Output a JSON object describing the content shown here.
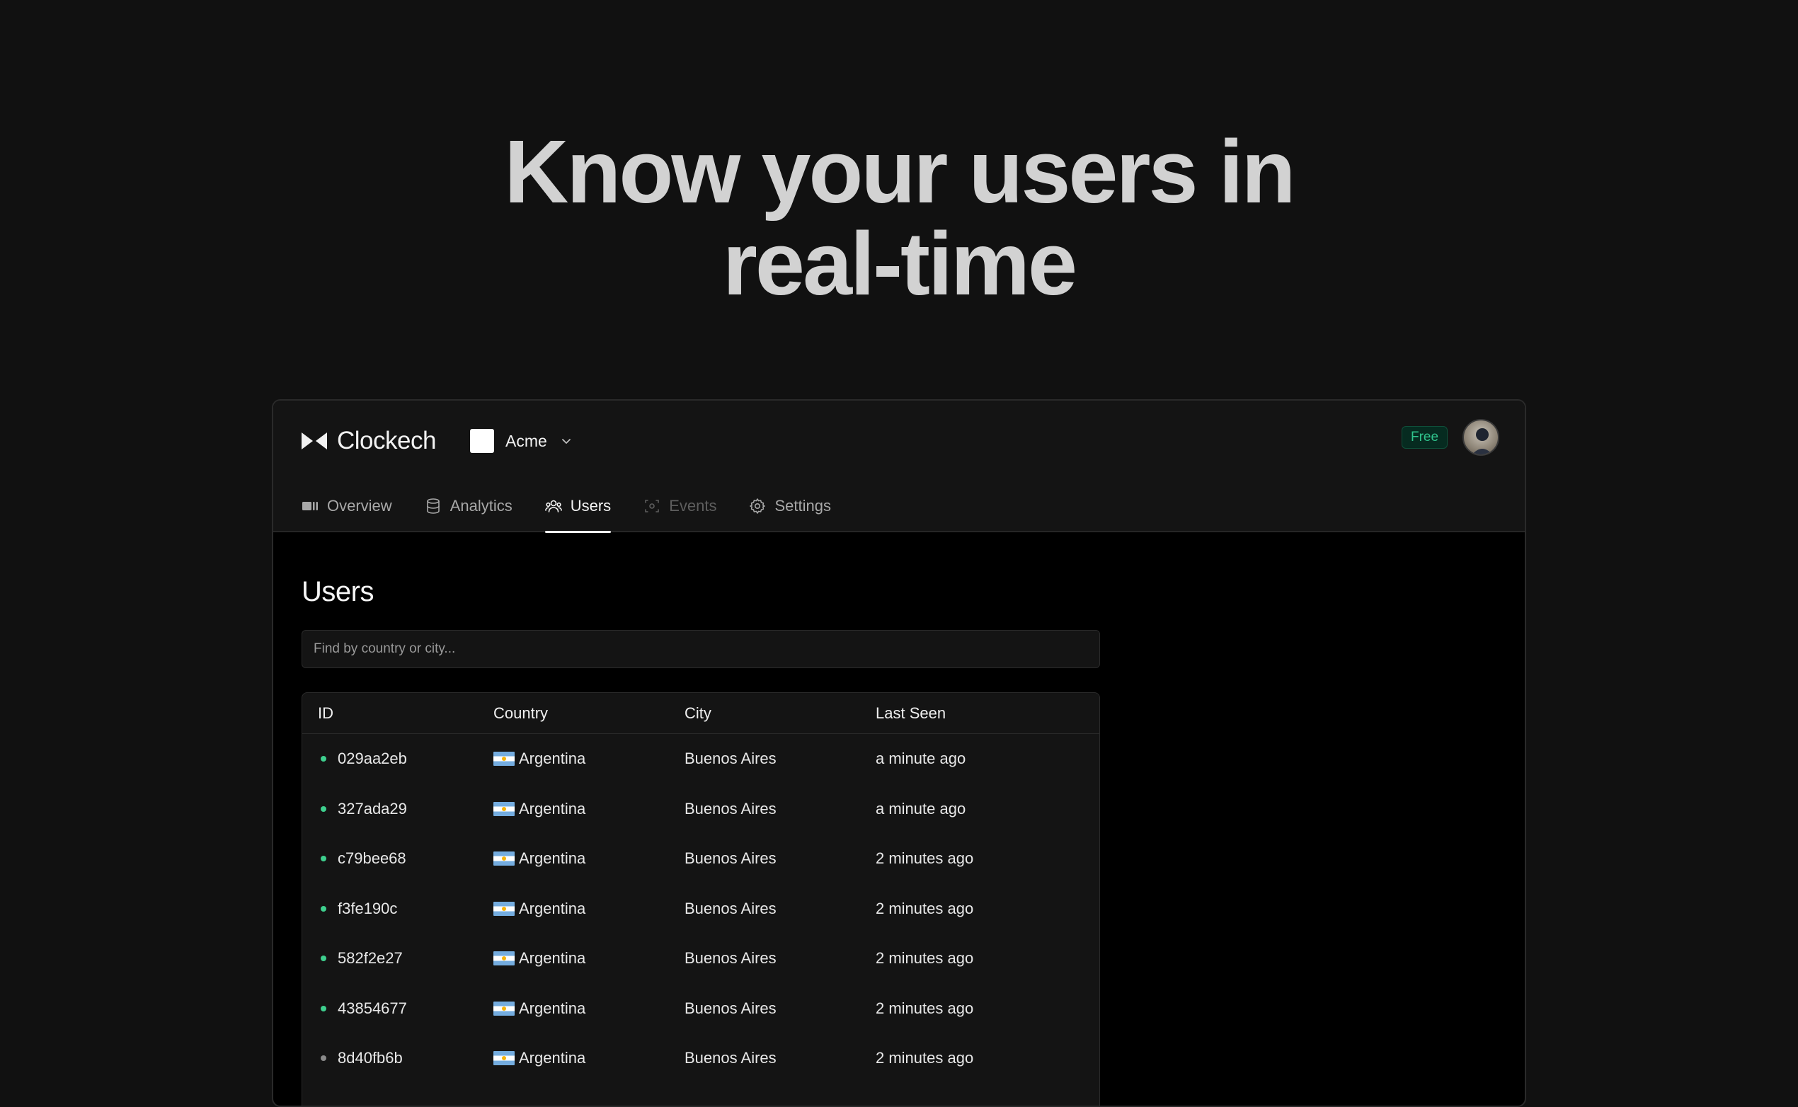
{
  "hero": {
    "line1": "Know your users in",
    "line2": "real-time"
  },
  "app": {
    "brand": {
      "name": "Clockech"
    },
    "team": {
      "name": "Acme"
    },
    "plan_badge": "Free",
    "tabs": [
      {
        "label": "Overview",
        "icon": "overview-icon",
        "state": "normal"
      },
      {
        "label": "Analytics",
        "icon": "database-icon",
        "state": "normal"
      },
      {
        "label": "Users",
        "icon": "users-icon",
        "state": "active"
      },
      {
        "label": "Events",
        "icon": "events-icon",
        "state": "disabled"
      },
      {
        "label": "Settings",
        "icon": "gear-icon",
        "state": "normal"
      }
    ],
    "page_title": "Users",
    "search": {
      "placeholder": "Find by country or city...",
      "value": ""
    },
    "table": {
      "headers": [
        "ID",
        "Country",
        "City",
        "Last Seen"
      ],
      "rows": [
        {
          "id": "029aa2eb",
          "country": "Argentina",
          "city": "Buenos Aires",
          "last_seen": "a minute ago",
          "online": true
        },
        {
          "id": "327ada29",
          "country": "Argentina",
          "city": "Buenos Aires",
          "last_seen": "a minute ago",
          "online": true
        },
        {
          "id": "c79bee68",
          "country": "Argentina",
          "city": "Buenos Aires",
          "last_seen": "2 minutes ago",
          "online": true
        },
        {
          "id": "f3fe190c",
          "country": "Argentina",
          "city": "Buenos Aires",
          "last_seen": "2 minutes ago",
          "online": true
        },
        {
          "id": "582f2e27",
          "country": "Argentina",
          "city": "Buenos Aires",
          "last_seen": "2 minutes ago",
          "online": true
        },
        {
          "id": "43854677",
          "country": "Argentina",
          "city": "Buenos Aires",
          "last_seen": "2 minutes ago",
          "online": true
        },
        {
          "id": "8d40fb6b",
          "country": "Argentina",
          "city": "Buenos Aires",
          "last_seen": "2 minutes ago",
          "online": false
        }
      ]
    },
    "colors": {
      "online": "#3ecf8e",
      "offline": "#8a8a8a",
      "badge_text": "#30c48d"
    }
  }
}
